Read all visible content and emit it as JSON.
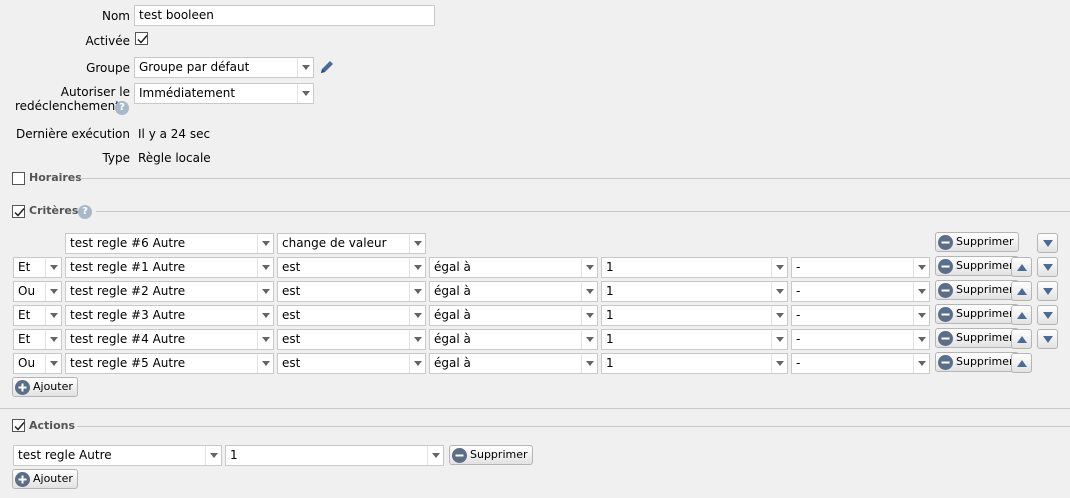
{
  "form": {
    "nom_label": "Nom",
    "nom_value": "test booleen",
    "activee_label": "Activée",
    "groupe_label": "Groupe",
    "groupe_value": "Groupe par défaut",
    "autoriser_label_line1": "Autoriser le",
    "autoriser_label_line2": "redéclenchement",
    "autoriser_value": "Immédiatement",
    "derniere_label": "Dernière exécution",
    "derniere_value": "Il y a 24 sec",
    "type_label": "Type",
    "type_value": "Règle locale"
  },
  "sections": {
    "horaires": "Horaires",
    "criteres": "Critères",
    "actions": "Actions"
  },
  "criteria": {
    "first": {
      "rule": "test regle #6 Autre",
      "event": "change de valeur"
    },
    "rows": [
      {
        "logic": "Et",
        "rule": "test regle #1 Autre",
        "cond": "est",
        "op": "égal à",
        "val": "1",
        "extra": "-"
      },
      {
        "logic": "Ou",
        "rule": "test regle #2 Autre",
        "cond": "est",
        "op": "égal à",
        "val": "1",
        "extra": "-"
      },
      {
        "logic": "Et",
        "rule": "test regle #3 Autre",
        "cond": "est",
        "op": "égal à",
        "val": "1",
        "extra": "-"
      },
      {
        "logic": "Et",
        "rule": "test regle #4 Autre",
        "cond": "est",
        "op": "égal à",
        "val": "1",
        "extra": "-"
      },
      {
        "logic": "Ou",
        "rule": "test regle #5 Autre",
        "cond": "est",
        "op": "égal à",
        "val": "1",
        "extra": "-"
      }
    ]
  },
  "actions": {
    "rule": "test regle Autre",
    "value": "1"
  },
  "buttons": {
    "supprimer": "Supprimer",
    "ajouter": "Ajouter"
  },
  "icons": {
    "help": "?",
    "edit": "pencil-icon",
    "remove": "minus-circle-icon",
    "add": "plus-circle-icon"
  },
  "colors": {
    "button_icon": "#5a6e88",
    "pencil": "#4a6a9a",
    "help_icon": "#a9b8c8"
  }
}
